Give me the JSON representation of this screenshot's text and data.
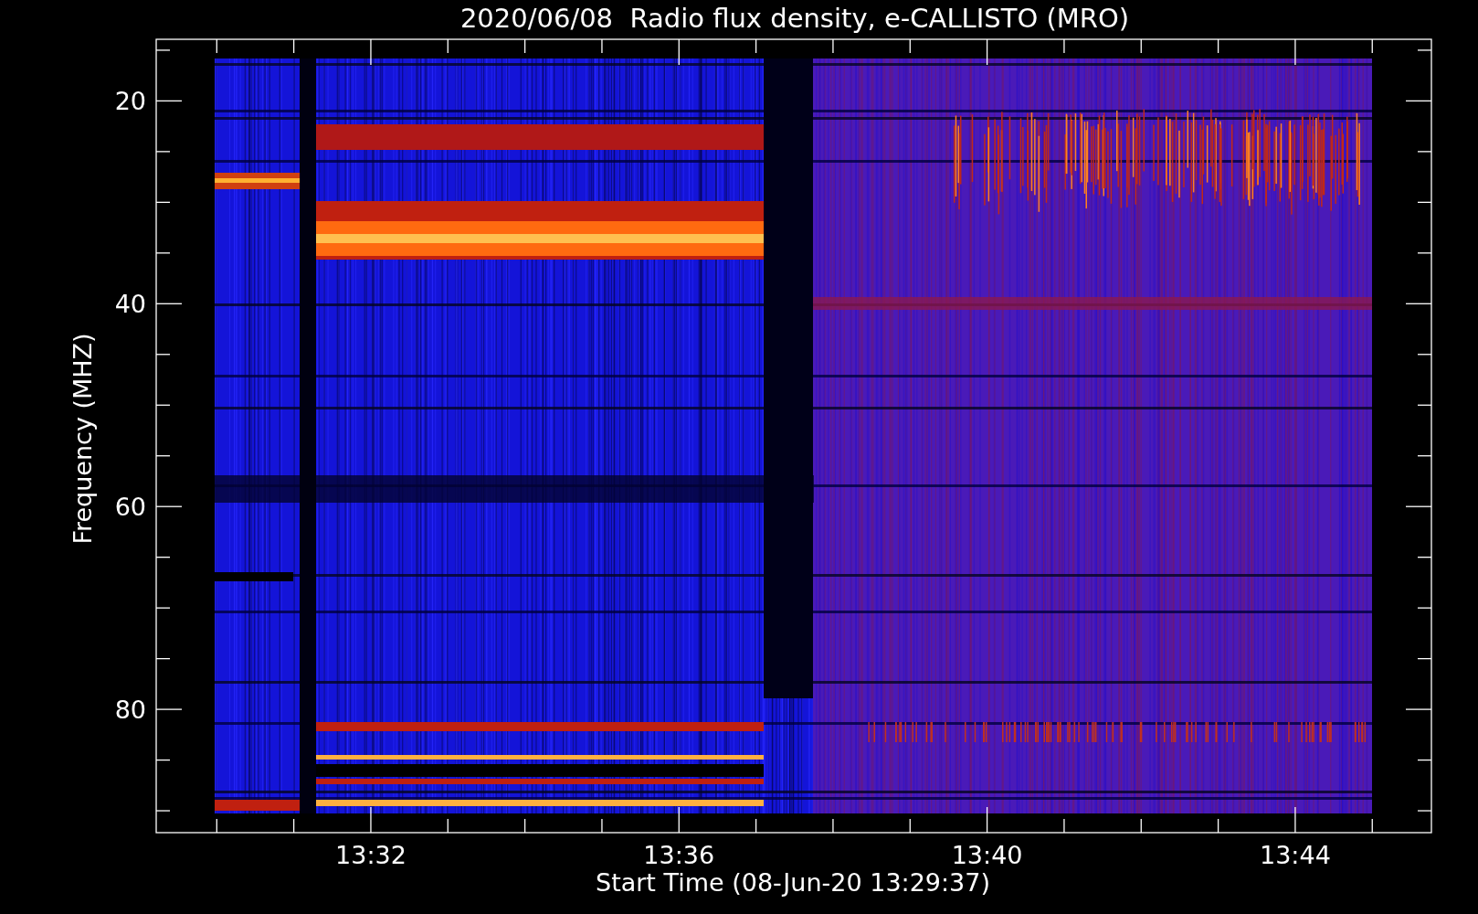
{
  "plot": {
    "title": "2020/06/08  Radio flux density, e-CALLISTO (MRO)",
    "ylabel": "Frequency (MHZ)",
    "xlabel": "Start Time (08-Jun-20 13:29:37)",
    "yticks": [
      "20",
      "40",
      "60",
      "80"
    ],
    "xticks": [
      "13:32",
      "13:36",
      "13:40",
      "13:44"
    ]
  }
}
